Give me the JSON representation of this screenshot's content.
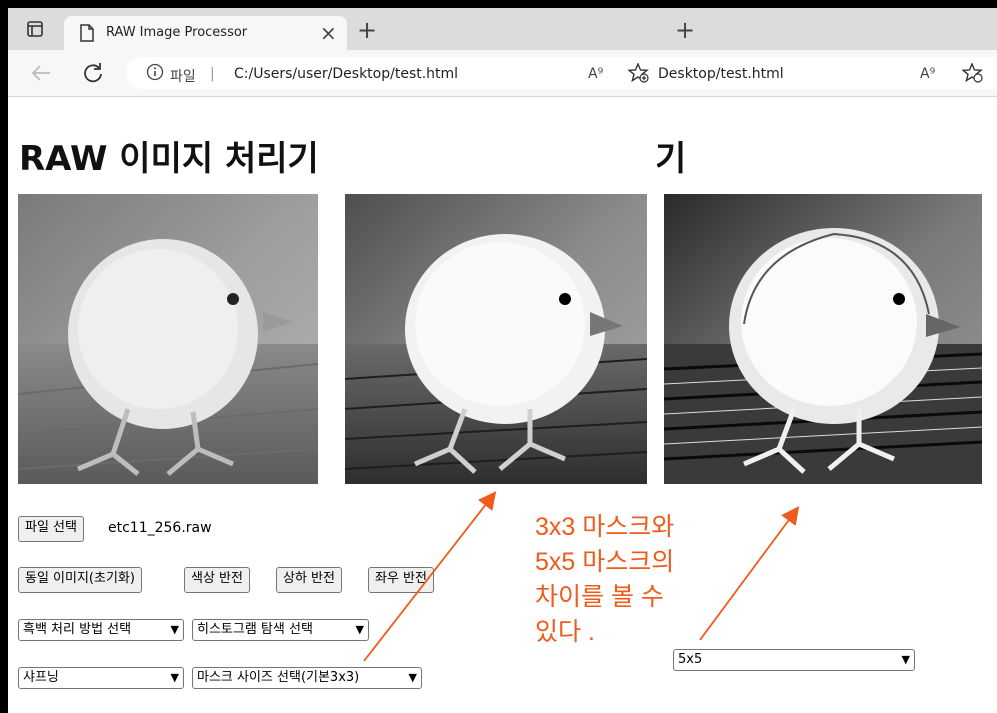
{
  "browser": {
    "tab_title": "RAW Image Processor",
    "url": "C:/Users/user/Desktop/test.html",
    "url_partial": "Desktop/test.html",
    "scheme_label": "파일",
    "close_glyph": "×",
    "new_tab_glyph": "+",
    "read_aloud_glyph": "A⁹"
  },
  "page": {
    "title": "RAW 이미지 처리기",
    "title_tail": "기",
    "file_button": "파일 선택",
    "file_name": "etc11_256.raw",
    "buttons": [
      "동일 이미지(초기화)",
      "색상 반전",
      "상하 반전",
      "좌우 반전"
    ],
    "grayscale_select": "흑백 처리 방법 선택",
    "histogram_select": "히스토그램 탐색 선택",
    "filter_select": "샤프닝",
    "mask_select": "마스크 사이즈 선택(기본3x3)",
    "mask_select_b": "5x5"
  },
  "annotation": {
    "lines": [
      "3x3  마스크와",
      "5x5  마스크의",
      "차이를 볼 수",
      "있다 ."
    ],
    "color": "#f05a1a"
  }
}
